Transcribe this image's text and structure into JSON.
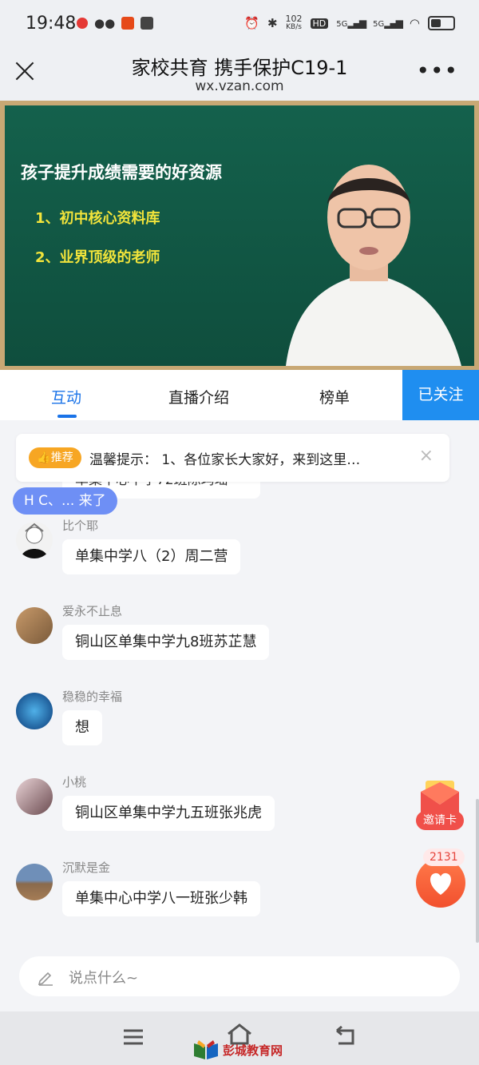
{
  "status_bar": {
    "time": "19:48",
    "network_speed": "102\nKB/s",
    "speed_top": "102",
    "speed_unit": "KB/s",
    "signal_1": "5G",
    "signal_2": "5G",
    "hd": "HD"
  },
  "header": {
    "title": "家校共育 携手保护C19-1",
    "domain": "wx.vzan.com",
    "more": "•••"
  },
  "video": {
    "board_title": "孩子提升成绩需要的好资源",
    "point_1": "1、初中核心资料库",
    "point_2": "2、业界顶级的老师"
  },
  "tabs": {
    "interact": "互动",
    "intro": "直播介绍",
    "ranking": "榜单",
    "follow": "已关注"
  },
  "notice": {
    "badge": "推荐",
    "text": "温馨提示：  1、各位家长大家好，来到这里…",
    "close": "×"
  },
  "partial_message": "单集中心中学72班陈玛瑶",
  "join_pill": "H C、... 来了",
  "messages": [
    {
      "name": "比个耶",
      "text": "单集中学八（2）周二营"
    },
    {
      "name": "爱永不止息",
      "text": "铜山区单集中学九8班苏芷慧"
    },
    {
      "name": "稳稳的幸福",
      "text": "想"
    },
    {
      "name": "小桃",
      "text": "铜山区单集中学九五班张兆虎"
    },
    {
      "name": "沉默是金",
      "text": "单集中心中学八一班张少韩"
    }
  ],
  "invite": {
    "label": "邀请卡"
  },
  "likes": {
    "count": "2131"
  },
  "input": {
    "placeholder": "说点什么~"
  },
  "watermark": {
    "text": "彭城教育网"
  },
  "colors": {
    "accent": "#1a73e8",
    "follow_bg": "#1f8ef0",
    "badge": "#f7a623",
    "like": "#f2502e"
  }
}
